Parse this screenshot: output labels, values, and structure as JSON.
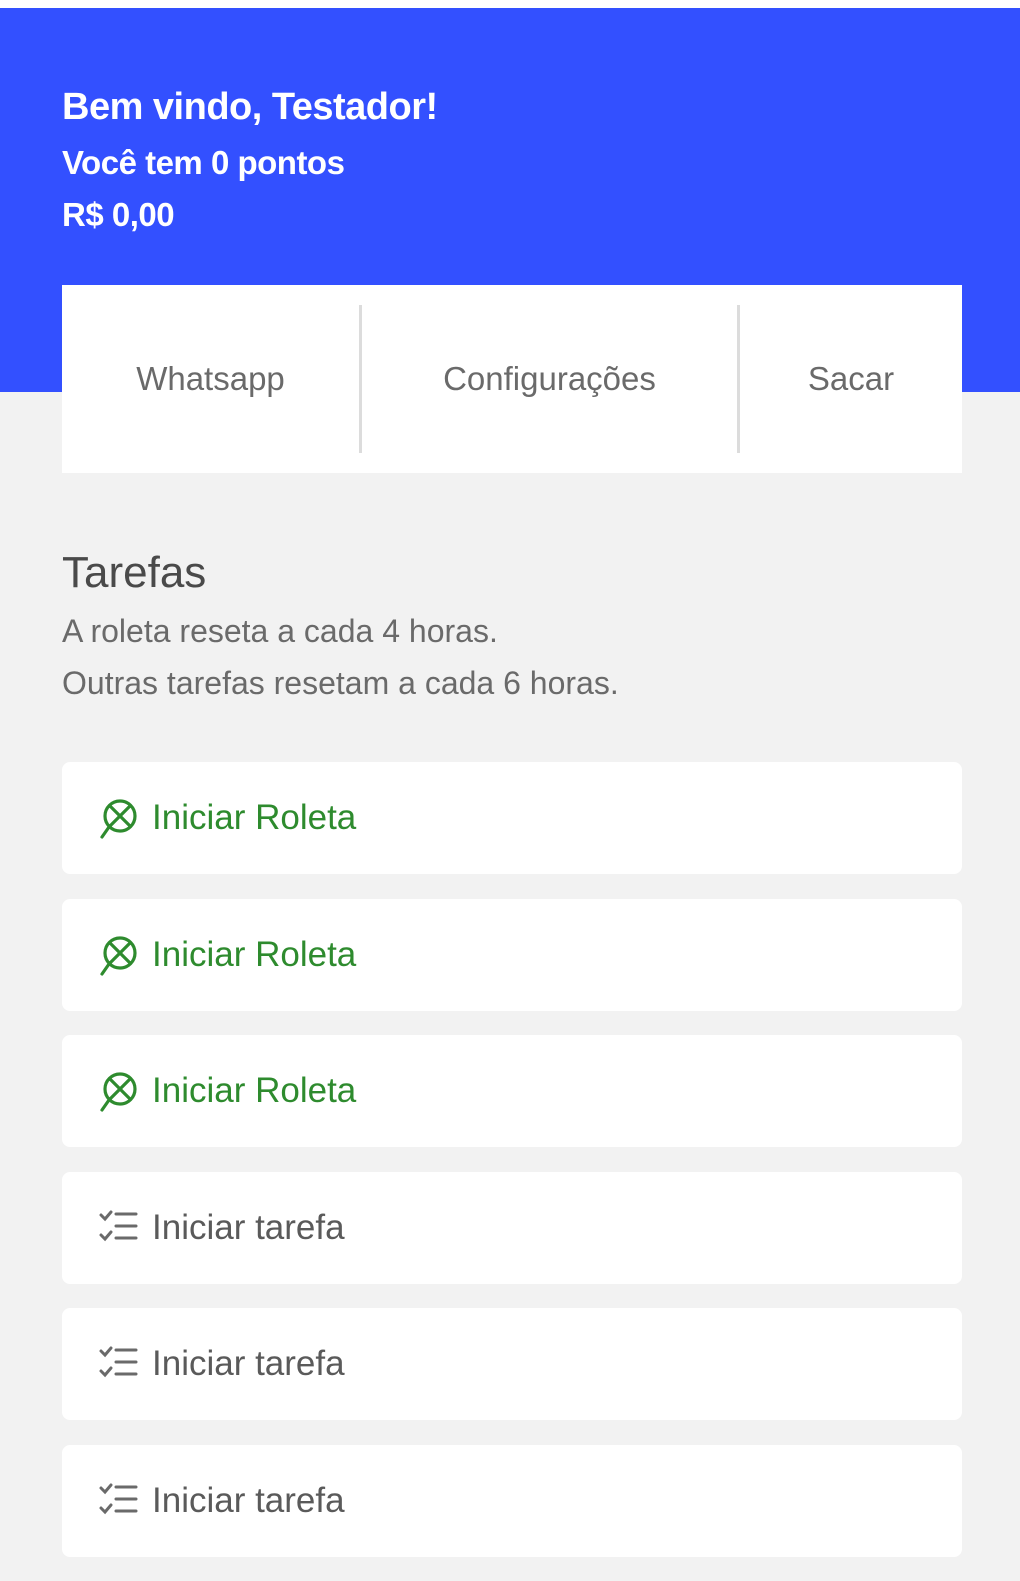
{
  "header": {
    "greeting": "Bem vindo, Testador!",
    "points": "Você tem 0 pontos",
    "balance": "R$ 0,00",
    "color": "#3350ff"
  },
  "nav": {
    "whatsapp": "Whatsapp",
    "settings": "Configurações",
    "withdraw": "Sacar"
  },
  "tasks_section": {
    "title": "Tarefas",
    "desc_line1": "A roleta reseta a cada 4 horas.",
    "desc_line2": "Outras tarefas resetam a cada 6 horas.",
    "items": [
      {
        "label": "Iniciar Roleta",
        "icon": "roulette-icon",
        "color": "#2e8b2e"
      },
      {
        "label": "Iniciar Roleta",
        "icon": "roulette-icon",
        "color": "#2e8b2e"
      },
      {
        "label": "Iniciar Roleta",
        "icon": "roulette-icon",
        "color": "#2e8b2e"
      },
      {
        "label": "Iniciar tarefa",
        "icon": "checklist-icon",
        "color": "#5a5a5a"
      },
      {
        "label": "Iniciar tarefa",
        "icon": "checklist-icon",
        "color": "#5a5a5a"
      },
      {
        "label": "Iniciar tarefa",
        "icon": "checklist-icon",
        "color": "#5a5a5a"
      }
    ]
  }
}
